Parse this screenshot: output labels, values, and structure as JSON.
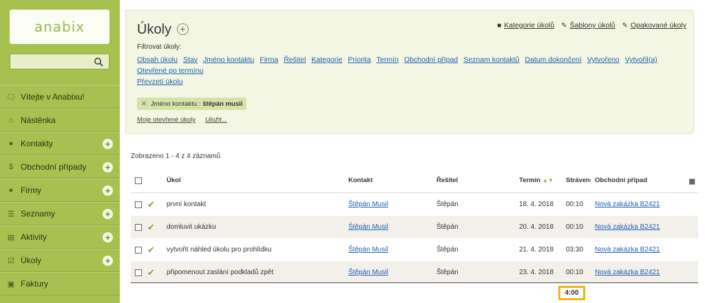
{
  "logo": "anabix",
  "sidebar": {
    "items": [
      {
        "label": "Vítejte v Anabixu!",
        "icon": "chat-icon",
        "plus": false
      },
      {
        "label": "Nástěnka",
        "icon": "home-icon",
        "plus": false
      },
      {
        "label": "Kontakty",
        "icon": "person-icon",
        "plus": true
      },
      {
        "label": "Obchodní případy",
        "icon": "dollar-icon",
        "plus": true
      },
      {
        "label": "Firmy",
        "icon": "people-icon",
        "plus": true
      },
      {
        "label": "Seznamy",
        "icon": "list-icon",
        "plus": true
      },
      {
        "label": "Aktivity",
        "icon": "clipboard-icon",
        "plus": true
      },
      {
        "label": "Úkoly",
        "icon": "task-icon",
        "plus": true
      },
      {
        "label": "Faktury",
        "icon": "invoice-icon",
        "plus": false
      }
    ]
  },
  "header": {
    "title": "Úkoly",
    "top_links": [
      "Kategorie úkolů",
      "Šablony úkolů",
      "Opakované úkoly"
    ]
  },
  "filter": {
    "label": "Filtrovat úkoly:",
    "links": [
      "Obsah úkolu",
      "Stav",
      "Jméno kontaktu",
      "Firma",
      "Řešitel",
      "Kategorie",
      "Priorita",
      "Termín",
      "Obchodní případ",
      "Seznam kontaktů",
      "Datum dokončení",
      "Vytvořeno",
      "Vytvořil(a)",
      "Otevřené po termínu",
      "Převzetí úkolu"
    ],
    "chip": {
      "key": "Jméno kontaktu :",
      "value": "štěpán musil"
    },
    "footer": {
      "my_open": "Moje otevřené úkoly",
      "save": "Uložit..."
    }
  },
  "table": {
    "count": "Zobrazeno 1 - 4 z 4 záznamů",
    "headers": {
      "task": "Úkol",
      "contact": "Kontakt",
      "resitel": "Řešitel",
      "termin": "Termín",
      "time": "Stráveno",
      "deal": "Obchodní případ"
    },
    "rows": [
      {
        "task": "první kontakt",
        "contact": "Štěpán Musil",
        "resitel": "Štěpán",
        "termin": "18. 4. 2018",
        "time": "00:10",
        "deal": "Nová zakázka B2421"
      },
      {
        "task": "domluvit ukázku",
        "contact": "Štěpán Musil",
        "resitel": "Štěpán",
        "termin": "20. 4. 2018",
        "time": "00:10",
        "deal": "Nová zakázka B2421"
      },
      {
        "task": "vytvořit náhled úkolu pro prohlídku",
        "contact": "Štěpán Musil",
        "resitel": "Štěpán",
        "termin": "21. 4. 2018",
        "time": "03:30",
        "deal": "Nová zakázka B2421"
      },
      {
        "task": "připomenout zaslání podkladů zpět",
        "contact": "Štěpán Musil",
        "resitel": "Štěpán",
        "termin": "23. 4. 2018",
        "time": "00:10",
        "deal": "Nová zakázka B2421"
      }
    ],
    "total": "4:00"
  },
  "colors": {
    "sidebar": "#a6c150",
    "panel": "#f2f6e2",
    "link": "#2060b0",
    "highlight": "#f2b21a"
  }
}
